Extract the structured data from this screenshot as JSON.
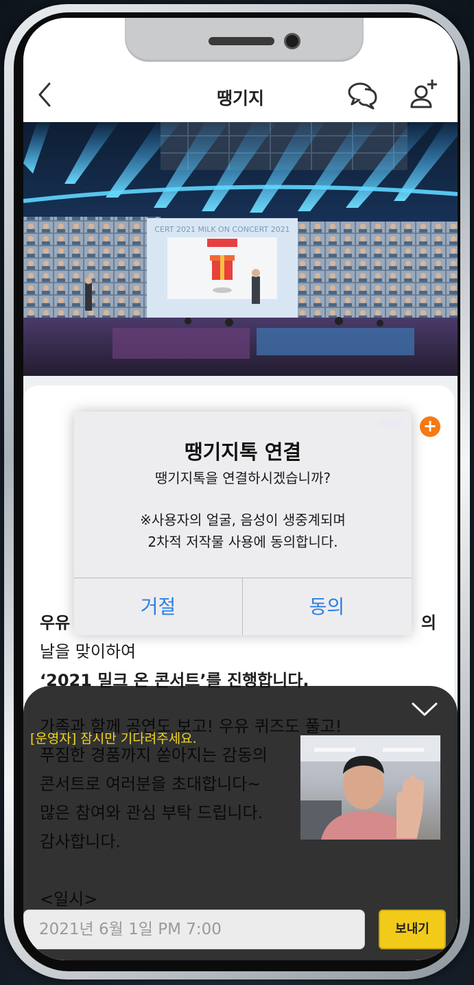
{
  "header": {
    "title": "땡기지",
    "back_icon": "chevron-left-icon",
    "chat_icon": "chat-bubbles-icon",
    "add_user_icon": "add-user-icon"
  },
  "hero": {
    "screen_text": "CERT 2021 MILK ON CONCERT 2021"
  },
  "card": {
    "plus_icon": "plus-circle-icon",
    "plus_label": "+",
    "body_lines": [
      "우유",
      "의",
      "날을 맞이하여",
      "‘2021 밀크 온 콘서트’를 진행합니다."
    ]
  },
  "dialog": {
    "title": "땡기지톡 연결",
    "message": "땡기지톡을 연결하시겠습니까?",
    "note_line1": "※사용자의 얼굴, 음성이 생중계되며",
    "note_line2": "2차적 저작물 사용에 동의합니다.",
    "decline_label": "거절",
    "accept_label": "동의"
  },
  "live": {
    "operator_message": "[운영자] 잠시만 기다려주세요.",
    "collapse_icon": "chevron-down-icon",
    "background_lines": [
      "가족과 함께 공연도 보고! 우유 퀴즈도 풀고!",
      "푸짐한  경품까지  쏟아지는  감동의",
      "콘서트로 여러분을 초대합니다~",
      "많은 참여와 관심 부탁 드립니다.",
      "감사합니다.",
      "",
      "<일시>"
    ],
    "input_value": "2021년 6월 1일 PM 7:00",
    "send_label": "보내기"
  },
  "colors": {
    "accent_blue": "#2b7fe4",
    "send_yellow": "#f2cb1a",
    "operator_yellow": "#f2d61f",
    "plus_orange": "#f57a15"
  }
}
